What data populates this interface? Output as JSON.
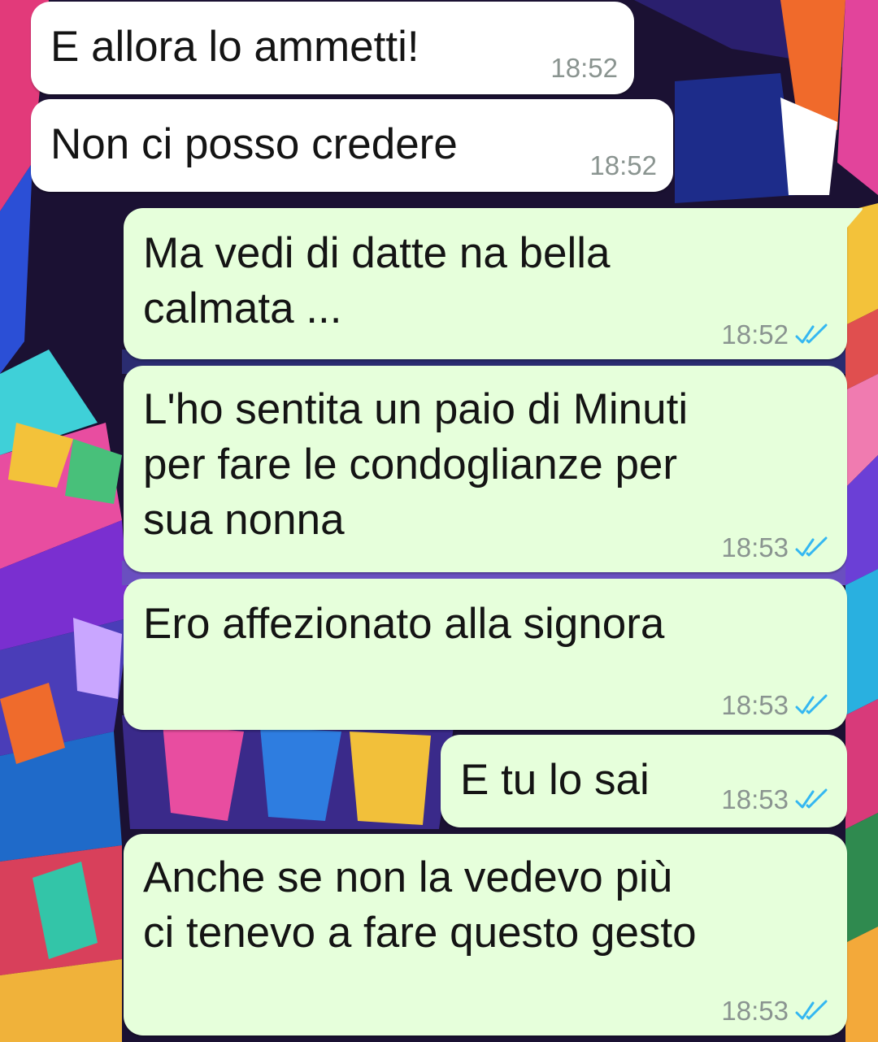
{
  "chat": {
    "messages": [
      {
        "direction": "incoming",
        "text": "E allora lo ammetti!",
        "time": "18:52",
        "status": ""
      },
      {
        "direction": "incoming",
        "text": "Non ci posso credere",
        "time": "18:52",
        "status": ""
      },
      {
        "direction": "outgoing",
        "text": "Ma vedi di datte na bella\ncalmata ...",
        "time": "18:52",
        "status": "read"
      },
      {
        "direction": "outgoing",
        "text": "L'ho sentita un paio di Minuti\nper fare le condoglianze per\nsua nonna",
        "time": "18:53",
        "status": "read"
      },
      {
        "direction": "outgoing",
        "text": "Ero affezionato alla signora",
        "time": "18:53",
        "status": "read"
      },
      {
        "direction": "outgoing",
        "text": "E tu lo sai",
        "time": "18:53",
        "status": "read"
      },
      {
        "direction": "outgoing",
        "text": "Anche se non la vedevo più\nci tenevo a fare questo gesto",
        "time": "18:53",
        "status": "read"
      }
    ]
  },
  "colors": {
    "incoming_bubble": "#ffffff",
    "outgoing_bubble": "#e6ffdb",
    "read_check": "#34b7f1",
    "time_text": "#8a9490",
    "message_text": "#141414"
  },
  "icons": {
    "read_status": "double-check-icon"
  }
}
